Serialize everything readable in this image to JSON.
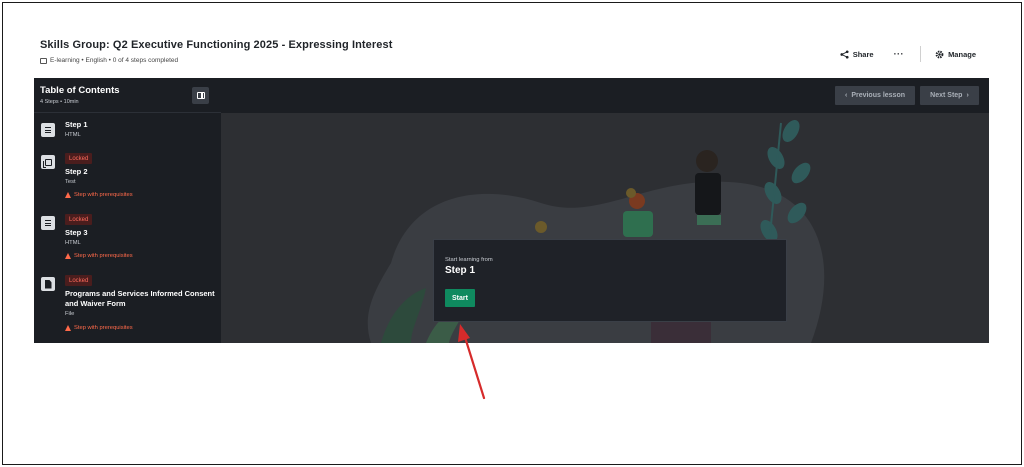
{
  "course": {
    "title": "Skills Group: Q2 Executive Functioning 2025 - Expressing Interest",
    "meta": "E-learning • English • 0 of 4 steps completed"
  },
  "header_actions": {
    "share_label": "Share",
    "more_label": "···",
    "manage_label": "Manage"
  },
  "toc": {
    "title": "Table of Contents",
    "meta": "4 Steps • 10min",
    "steps": [
      {
        "name": "Step 1",
        "type": "HTML",
        "icon": "document-lines-icon",
        "locked": false
      },
      {
        "name": "Step 2",
        "type": "Test",
        "icon": "test-stack-icon",
        "locked": true,
        "locked_label": "Locked",
        "prereq_label": "Step with prerequisites"
      },
      {
        "name": "Step 3",
        "type": "HTML",
        "icon": "document-lines-icon",
        "locked": true,
        "locked_label": "Locked",
        "prereq_label": "Step with prerequisites"
      },
      {
        "name": "Programs and Services Informed Consent and Waiver Form",
        "type": "File",
        "icon": "file-icon",
        "locked": true,
        "locked_label": "Locked",
        "prereq_label": "Step with prerequisites"
      }
    ]
  },
  "nav": {
    "prev_label": "Previous lesson",
    "next_label": "Next Step"
  },
  "start_card": {
    "subtitle": "Start learning from",
    "step": "Step 1",
    "button_label": "Start"
  },
  "colors": {
    "player_bg": "#1f2228",
    "accent_green": "#0f8a5f",
    "locked_red": "#ff6a5c",
    "annotation_arrow": "#d62b2b"
  }
}
